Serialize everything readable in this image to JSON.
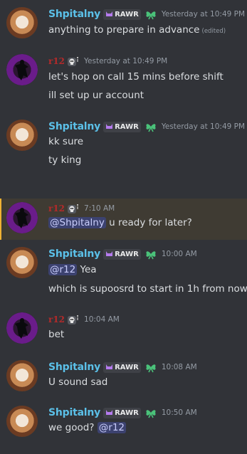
{
  "users": {
    "shpitalny": {
      "name": "Shpitalny",
      "tag": "RAWR"
    },
    "r12": {
      "name": "r12"
    }
  },
  "messages": [
    {
      "author": "Shpitalny",
      "time": "Yesterday at 10:49 PM",
      "lines": [
        {
          "text": "anything to prepare in advance",
          "edited": "(edited)"
        }
      ]
    },
    {
      "author": "r12",
      "time": "Yesterday at 10:49 PM",
      "lines": [
        {
          "text": "let's hop on call 15 mins before shift"
        },
        {
          "text": "ill set up ur account"
        }
      ]
    },
    {
      "author": "Shpitalny",
      "time": "Yesterday at 10:49 PM",
      "lines": [
        {
          "text": "kk sure"
        },
        {
          "text": "ty king"
        }
      ]
    },
    {
      "author": "r12",
      "time": "7:10 AM",
      "lines": [
        {
          "mention": "@Shpitalny",
          "text": "u ready for later?"
        }
      ]
    },
    {
      "author": "Shpitalny",
      "time": "10:00 AM",
      "lines": [
        {
          "mention": "@r12",
          "text": "Yea"
        },
        {
          "text": "which is supoosrd to start in 1h from now"
        }
      ]
    },
    {
      "author": "r12",
      "time": "10:04 AM",
      "lines": [
        {
          "text": "bet"
        }
      ]
    },
    {
      "author": "Shpitalny",
      "time": "10:08 AM",
      "lines": [
        {
          "text": "U sound sad"
        }
      ]
    },
    {
      "author": "Shpitalny",
      "time": "10:50 AM",
      "lines": [
        {
          "text": "we good?",
          "mention_after": "@r12"
        }
      ]
    }
  ],
  "colors": {
    "background": "#313338",
    "shpitalny_name": "#5bc0e8",
    "r12_name": "#b42a2a",
    "mention_bg": "#3c4270",
    "highlight_bg": "#3f3b33"
  },
  "icons": {
    "tag_icon": "purple-cat-icon",
    "role_icon": "green-leaf-icon",
    "r12_badge": "skull-icon"
  }
}
